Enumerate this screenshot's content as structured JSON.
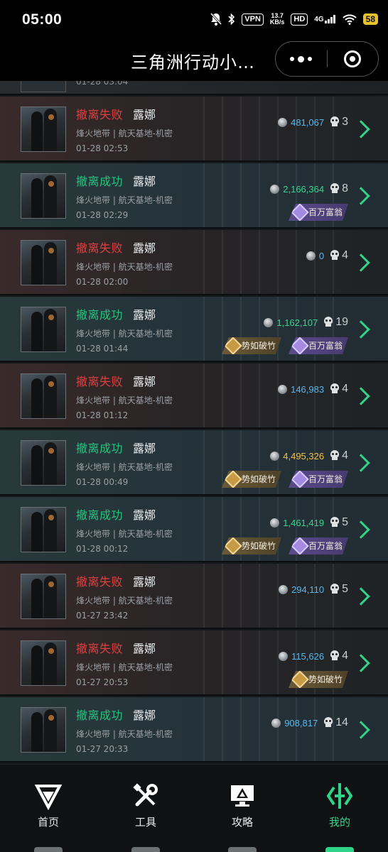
{
  "status_bar": {
    "time": "05:00",
    "vpn": "VPN",
    "speed_top": "13.7",
    "speed_bottom": "KB/s",
    "hd": "HD",
    "network": "4G",
    "battery": "58"
  },
  "title_bar": {
    "title": "三角洲行动小…"
  },
  "list": {
    "peek_date": "01-28 03:04",
    "rows": [
      {
        "result": "撤离失败",
        "result_type": "fail",
        "operator": "露娜",
        "map": "烽火地带 | 航天基地-机密",
        "time": "01-28 02:53",
        "value": "481,067",
        "value_color": "blue",
        "kills": "3",
        "badges": []
      },
      {
        "result": "撤离成功",
        "result_type": "succ",
        "operator": "露娜",
        "map": "烽火地带 | 航天基地-机密",
        "time": "01-28 02:29",
        "value": "2,166,364",
        "value_color": "green",
        "kills": "8",
        "badges": [
          "百万富翁"
        ]
      },
      {
        "result": "撤离失败",
        "result_type": "fail",
        "operator": "露娜",
        "map": "烽火地带 | 航天基地-机密",
        "time": "01-28 02:00",
        "value": "0",
        "value_color": "blue",
        "kills": "4",
        "badges": []
      },
      {
        "result": "撤离成功",
        "result_type": "succ",
        "operator": "露娜",
        "map": "烽火地带 | 航天基地-机密",
        "time": "01-28 01:44",
        "value": "1,162,107",
        "value_color": "green",
        "kills": "19",
        "badges": [
          "势如破竹",
          "百万富翁"
        ]
      },
      {
        "result": "撤离失败",
        "result_type": "fail",
        "operator": "露娜",
        "map": "烽火地带 | 航天基地-机密",
        "time": "01-28 01:12",
        "value": "146,983",
        "value_color": "blue",
        "kills": "4",
        "badges": []
      },
      {
        "result": "撤离成功",
        "result_type": "succ",
        "operator": "露娜",
        "map": "烽火地带 | 航天基地-机密",
        "time": "01-28 00:49",
        "value": "4,495,326",
        "value_color": "gold",
        "kills": "4",
        "badges": [
          "势如破竹",
          "百万富翁"
        ]
      },
      {
        "result": "撤离成功",
        "result_type": "succ",
        "operator": "露娜",
        "map": "烽火地带 | 航天基地-机密",
        "time": "01-28 00:12",
        "value": "1,461,419",
        "value_color": "green",
        "kills": "5",
        "badges": [
          "势如破竹",
          "百万富翁"
        ]
      },
      {
        "result": "撤离失败",
        "result_type": "fail",
        "operator": "露娜",
        "map": "烽火地带 | 航天基地-机密",
        "time": "01-27 23:42",
        "value": "294,110",
        "value_color": "blue",
        "kills": "5",
        "badges": []
      },
      {
        "result": "撤离失败",
        "result_type": "fail",
        "operator": "露娜",
        "map": "烽火地带 | 航天基地-机密",
        "time": "01-27 20:53",
        "value": "115,626",
        "value_color": "blue",
        "kills": "4",
        "badges": [
          "势如破竹"
        ]
      },
      {
        "result": "撤离成功",
        "result_type": "succ",
        "operator": "露娜",
        "map": "烽火地带 | 航天基地-机密",
        "time": "01-27 20:33",
        "value": "908,817",
        "value_color": "blue",
        "kills": "14",
        "badges": []
      }
    ]
  },
  "bottom_nav": {
    "items": [
      {
        "label": "首页",
        "icon": "home-logo-icon",
        "active": false
      },
      {
        "label": "工具",
        "icon": "tools-icon",
        "active": false
      },
      {
        "label": "攻略",
        "icon": "guide-monitor-icon",
        "active": false
      },
      {
        "label": "我的",
        "icon": "profile-logo-icon",
        "active": true
      }
    ]
  },
  "colors": {
    "fail": "#e0413f",
    "success": "#28c47e",
    "accent": "#2fd48a",
    "value_blue": "#5ab8ee",
    "value_gold": "#f0c348"
  }
}
